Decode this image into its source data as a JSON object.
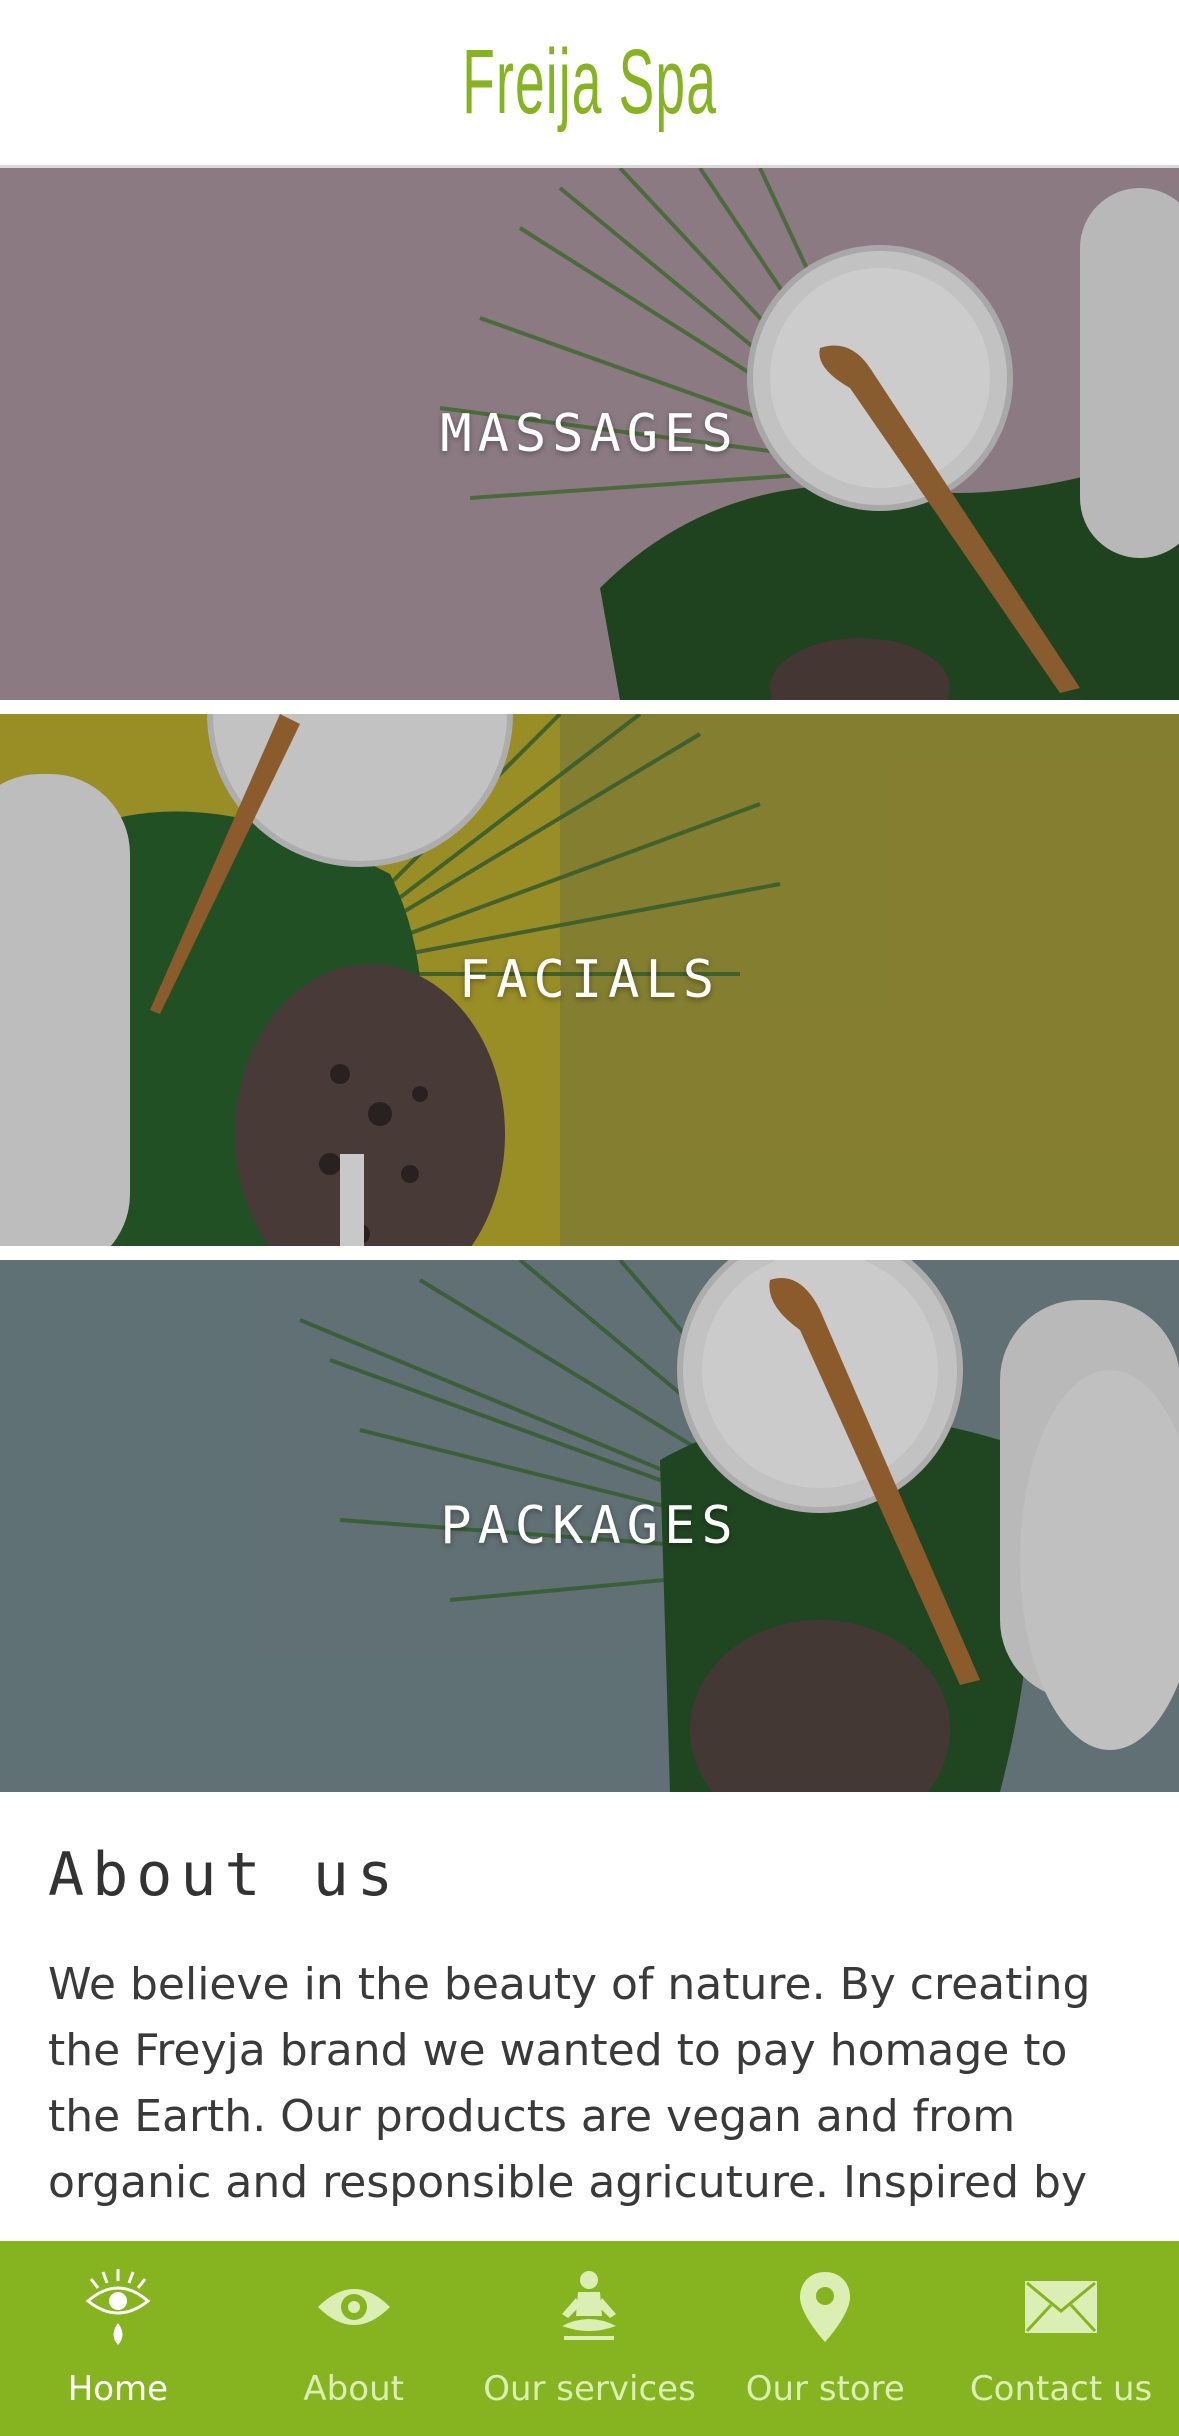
{
  "header": {
    "logo_text": "Freija Spa",
    "brand_color": "#86b320"
  },
  "banners": [
    {
      "title": "MASSAGES",
      "tint": "#a48f99"
    },
    {
      "title": "FACIALS",
      "tint": "#9c9432"
    },
    {
      "title": "PACKAGES",
      "tint": "#6e8388"
    }
  ],
  "about": {
    "heading": "About us",
    "body": "We believe in the beauty of nature. By creating the Freyja brand we wanted to pay homage to the Earth. Our products are vegan and from organic and responsible agricuture. Inspired by"
  },
  "tabbar": {
    "background": "#86b320",
    "items": [
      {
        "label": "Home",
        "icon": "eye-tear-icon",
        "active": true
      },
      {
        "label": "About",
        "icon": "eye-icon",
        "active": false
      },
      {
        "label": "Our services",
        "icon": "meditation-icon",
        "active": false
      },
      {
        "label": "Our store",
        "icon": "location-pin-icon",
        "active": false
      },
      {
        "label": "Contact us",
        "icon": "envelope-icon",
        "active": false
      }
    ]
  }
}
